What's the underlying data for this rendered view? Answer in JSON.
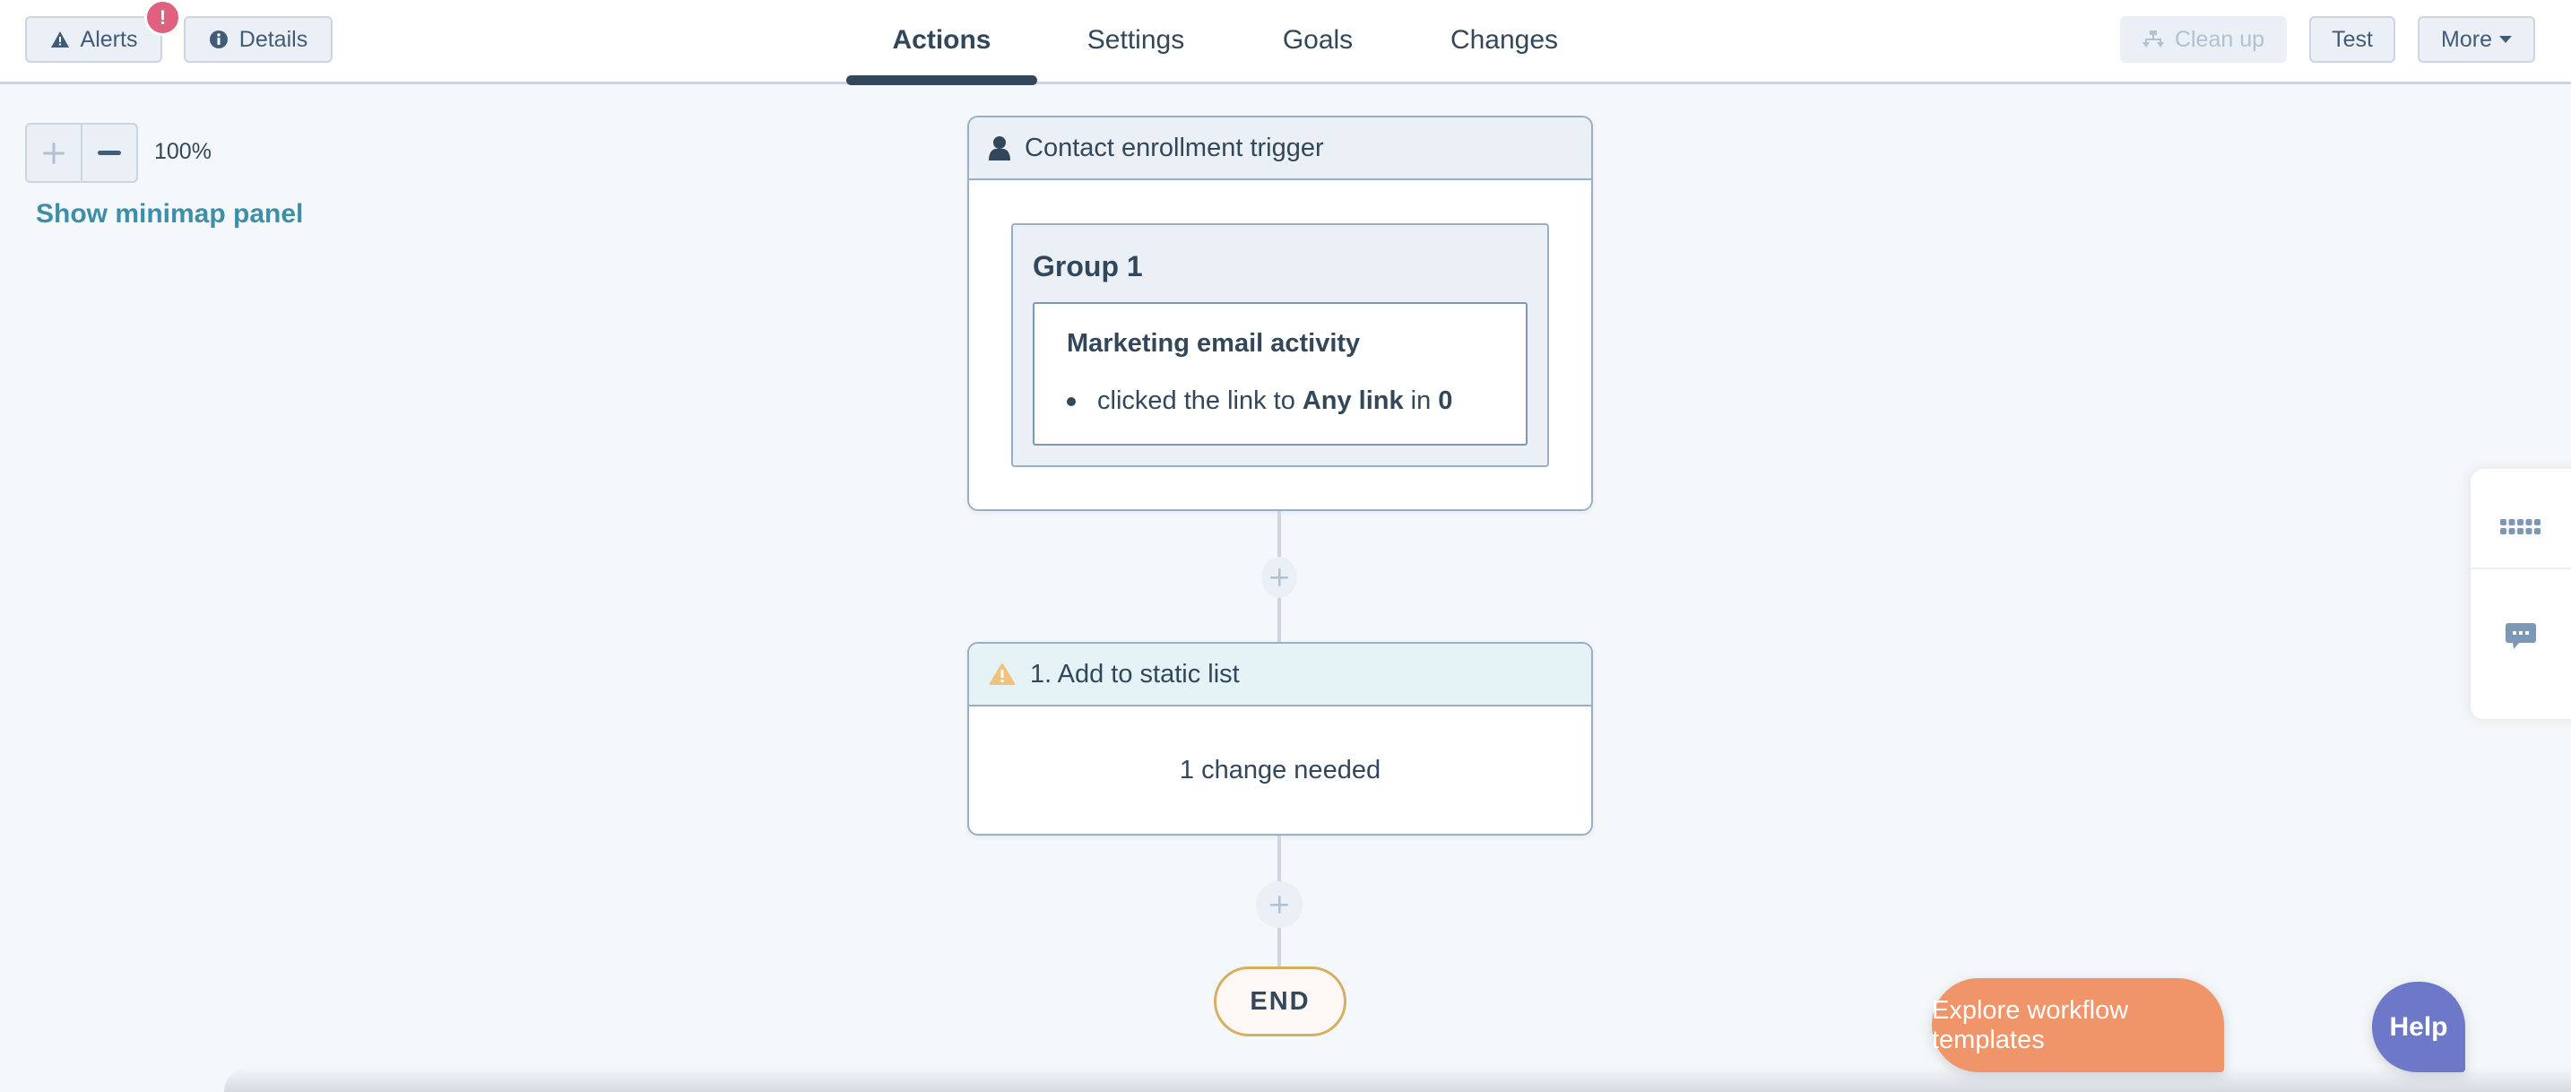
{
  "toolbar": {
    "alerts_label": "Alerts",
    "alerts_badge": "!",
    "details_label": "Details",
    "clean_up_label": "Clean up",
    "test_label": "Test",
    "more_label": "More"
  },
  "tabs": [
    {
      "label": "Actions",
      "active": true
    },
    {
      "label": "Settings",
      "active": false
    },
    {
      "label": "Goals",
      "active": false
    },
    {
      "label": "Changes",
      "active": false
    }
  ],
  "canvas": {
    "zoom_level": "100%",
    "minimap_link": "Show minimap panel"
  },
  "trigger": {
    "icon": "contact-person-icon",
    "title": "Contact enrollment trigger",
    "group_title": "Group 1",
    "filter_title": "Marketing email activity",
    "filter_text_1": "clicked the link to",
    "filter_bold_1": "Any link",
    "filter_text_2": "in",
    "filter_bold_2": "0"
  },
  "action": {
    "icon": "warning-icon",
    "title": "1. Add to static list",
    "status": "1 change needed"
  },
  "end_label": "END",
  "side_panel": {
    "items": [
      "keyboard-icon",
      "chat-icon"
    ]
  },
  "floating": {
    "explore_label": "Explore workflow templates",
    "help_label": "Help"
  },
  "colors": {
    "badge": "#e0617f",
    "link": "#3d8fa9",
    "warning": "#f0c27b",
    "explore": "#f0956a",
    "help": "#6e78c9",
    "end_border": "#d6ae63"
  }
}
